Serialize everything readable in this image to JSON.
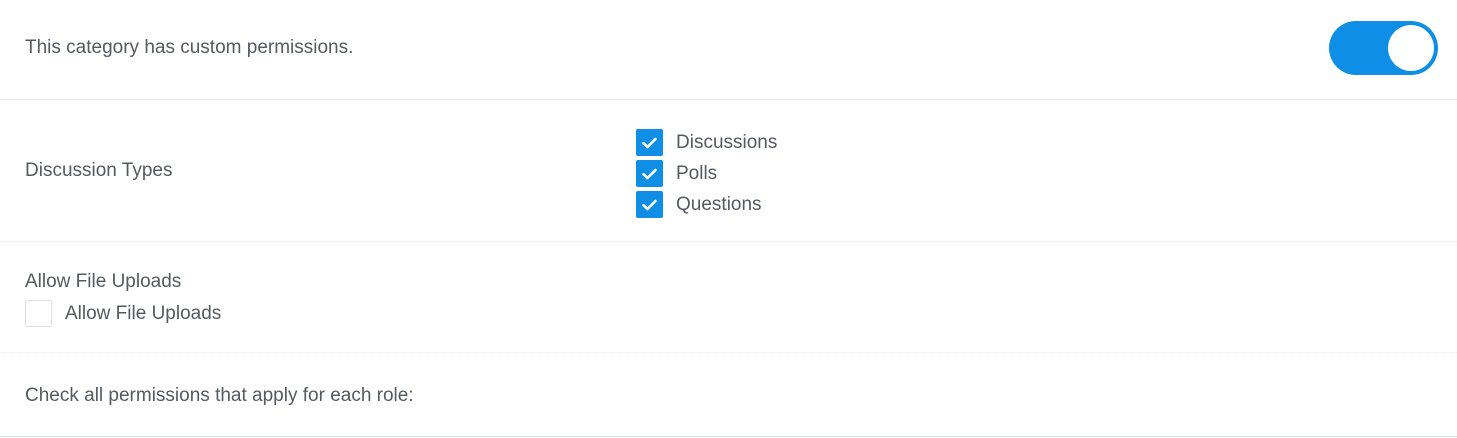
{
  "custom_permissions": {
    "label": "This category has custom permissions.",
    "toggle_on": true,
    "accent_color": "#0f8ee5"
  },
  "discussion_types": {
    "label": "Discussion Types",
    "options": [
      {
        "label": "Discussions",
        "checked": true
      },
      {
        "label": "Polls",
        "checked": true
      },
      {
        "label": "Questions",
        "checked": true
      }
    ]
  },
  "file_uploads": {
    "label": "Allow File Uploads",
    "option": {
      "label": "Allow File Uploads",
      "checked": false
    }
  },
  "role_permissions": {
    "label": "Check all permissions that apply for each role:"
  },
  "icons": {
    "checkmark": "check-icon"
  }
}
